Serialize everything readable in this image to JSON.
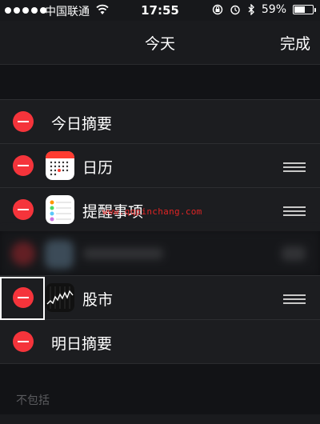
{
  "status_bar": {
    "carrier": "中国联通",
    "time": "17:55",
    "battery_percent": "59%",
    "battery_level": 0.59,
    "icons": [
      "signal-dots-icon",
      "wifi-icon",
      "rotation-lock-icon",
      "alarm-icon",
      "bluetooth-icon",
      "battery-icon"
    ]
  },
  "nav": {
    "title": "今天",
    "done_label": "完成"
  },
  "included_items": [
    {
      "label": "今日摘要",
      "icon": null,
      "reorder": false
    },
    {
      "label": "日历",
      "icon": "calendar-app-icon",
      "reorder": true
    },
    {
      "label": "提醒事项",
      "icon": "reminders-app-icon",
      "reorder": true
    },
    {
      "label": "",
      "icon": "blurred-app-icon",
      "reorder": true
    },
    {
      "label": "股市",
      "icon": "stocks-app-icon",
      "reorder": true
    },
    {
      "label": "明日摘要",
      "icon": null,
      "reorder": false
    }
  ],
  "watermark": "www.qqpinchang.com",
  "excluded_section": {
    "header": "不包括"
  },
  "colors": {
    "delete_red": "#f5343b",
    "background": "#0f1013",
    "row_background": "#1c1d20"
  }
}
